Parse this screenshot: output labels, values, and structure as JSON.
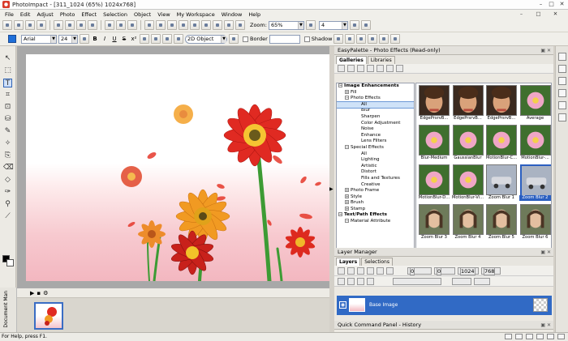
{
  "window": {
    "title": "PhotoImpact - [311_1024 (65%) 1024x768]",
    "minimize": "–",
    "maximize": "□",
    "close": "✕"
  },
  "menu": [
    "File",
    "Edit",
    "Adjust",
    "Photo",
    "Effect",
    "Selection",
    "Object",
    "View",
    "My Workspace",
    "Window",
    "Help"
  ],
  "toolbar": {
    "zoom_label": "Zoom:",
    "zoom_value": "65%",
    "percent_value": "4"
  },
  "attrbar": {
    "font": "Arial",
    "size": "24",
    "object_mode": "2D Object",
    "border_label": "Border",
    "shadow_label": "Shadow",
    "bold": "B",
    "italic": "I",
    "underline": "U",
    "strike": "S",
    "superscript": "x²"
  },
  "palette": {
    "header": "EasyPalette - Photo Effects (Read-only)",
    "tabs": [
      "Galleries",
      "Libraries"
    ],
    "tree": [
      {
        "label": "Image Enhancements",
        "level": 0,
        "box": "−"
      },
      {
        "label": "Fill",
        "level": 1,
        "box": "+"
      },
      {
        "label": "Photo Effects",
        "level": 1,
        "box": "−"
      },
      {
        "label": "All",
        "level": 2,
        "selected": true
      },
      {
        "label": "Blur",
        "level": 2
      },
      {
        "label": "Sharpen",
        "level": 2
      },
      {
        "label": "Color Adjustment",
        "level": 2
      },
      {
        "label": "Noise",
        "level": 2
      },
      {
        "label": "Enhance",
        "level": 2
      },
      {
        "label": "Lens Filters",
        "level": 2
      },
      {
        "label": "Special Effects",
        "level": 1,
        "box": "−"
      },
      {
        "label": "All",
        "level": 2
      },
      {
        "label": "Lighting",
        "level": 2
      },
      {
        "label": "Artistic",
        "level": 2
      },
      {
        "label": "Distort",
        "level": 2
      },
      {
        "label": "Fills and Textures",
        "level": 2
      },
      {
        "label": "Creative",
        "level": 2
      },
      {
        "label": "Photo Frame",
        "level": 1,
        "box": "+"
      },
      {
        "label": "Style",
        "level": 1,
        "box": "+"
      },
      {
        "label": "Brush",
        "level": 1,
        "box": "+"
      },
      {
        "label": "Stamp",
        "level": 1,
        "box": "+"
      },
      {
        "label": "Text/Path Effects",
        "level": 0,
        "box": "−"
      },
      {
        "label": "Material Attribute",
        "level": 1,
        "box": "−"
      }
    ],
    "thumbs": [
      {
        "label": "EdgePrsrvB...",
        "kind": "face"
      },
      {
        "label": "EdgePrsrvB...",
        "kind": "face"
      },
      {
        "label": "EdgePrsrvB...",
        "kind": "face"
      },
      {
        "label": "Average",
        "kind": "flower"
      },
      {
        "label": "Blur-Medium",
        "kind": "flower"
      },
      {
        "label": "GaussianBlur",
        "kind": "flower"
      },
      {
        "label": "MotionBlur-C...",
        "kind": "flower"
      },
      {
        "label": "MotionBlur-...",
        "kind": "flower"
      },
      {
        "label": "MotionBlur-D...",
        "kind": "flower"
      },
      {
        "label": "MotionBlur-Vi...",
        "kind": "flower"
      },
      {
        "label": "Zoom Blur 1",
        "kind": "car"
      },
      {
        "label": "Zoom Blur 2",
        "kind": "car",
        "selected": true
      },
      {
        "label": "Zoom Blur 3",
        "kind": "portrait"
      },
      {
        "label": "Zoom Blur 4",
        "kind": "portrait"
      },
      {
        "label": "Zoom Blur 5",
        "kind": "portrait"
      },
      {
        "label": "Zoom Blur 6",
        "kind": "portrait"
      }
    ]
  },
  "layers": {
    "header": "Layer Manager",
    "tabs": [
      "Layers",
      "Selections"
    ],
    "fields": [
      "0",
      "0",
      "1024",
      "768"
    ],
    "row": {
      "name": "Base Image"
    }
  },
  "qcp": {
    "header": "Quick Command Panel - History"
  },
  "docman": {
    "title": "Document Man"
  },
  "status": {
    "text": "For Help, press F1."
  },
  "colors": {
    "accent": "#316ac5",
    "layer_row": "#316ac5",
    "canvas_pink": "#f3b7c0"
  }
}
